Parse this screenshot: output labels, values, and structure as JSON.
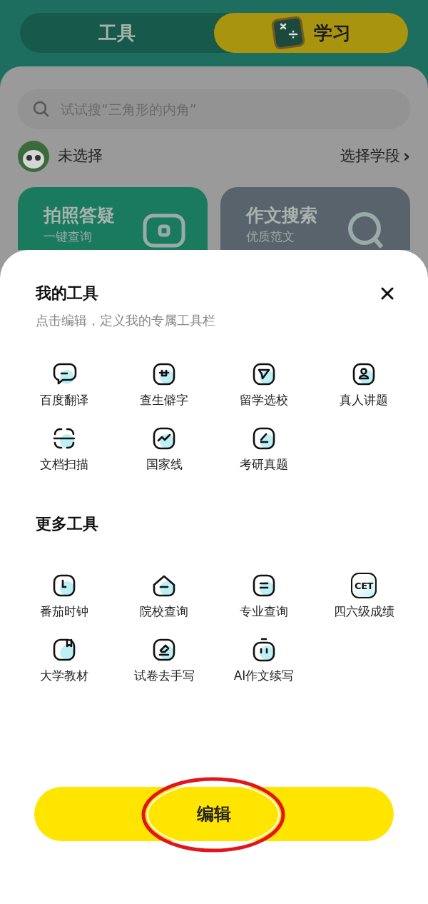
{
  "tabs": [
    {
      "label": "工具",
      "selected": false
    },
    {
      "label": "学习",
      "selected": true
    }
  ],
  "search": {
    "placeholder": "试试搜“三角形的内角”"
  },
  "grade": {
    "value": "未选择",
    "action": "选择学段",
    "chevron": "›"
  },
  "feature_cards": [
    {
      "title": "拍照答疑",
      "subtitle": "一键查询",
      "color": "#1a7a5e"
    },
    {
      "title": "作文搜索",
      "subtitle": "优质范文",
      "color": "#59636c"
    }
  ],
  "sheet": {
    "title": "我的工具",
    "subtitle": "点击编辑，定义我的专属工具栏",
    "my_tools": [
      {
        "label": "百度翻译"
      },
      {
        "label": "查生僻字"
      },
      {
        "label": "留学选校"
      },
      {
        "label": "真人讲题"
      },
      {
        "label": "文档扫描"
      },
      {
        "label": "国家线"
      },
      {
        "label": "考研真题"
      }
    ],
    "more_title": "更多工具",
    "more_tools": [
      {
        "label": "番茄时钟"
      },
      {
        "label": "院校查询"
      },
      {
        "label": "专业查询"
      },
      {
        "label": "四六级成绩",
        "icon_text": "CET"
      },
      {
        "label": "大学教材"
      },
      {
        "label": "试卷去手写"
      },
      {
        "label": "AI作文续写"
      }
    ],
    "edit_button": "编辑",
    "edit_highlighted": true
  }
}
